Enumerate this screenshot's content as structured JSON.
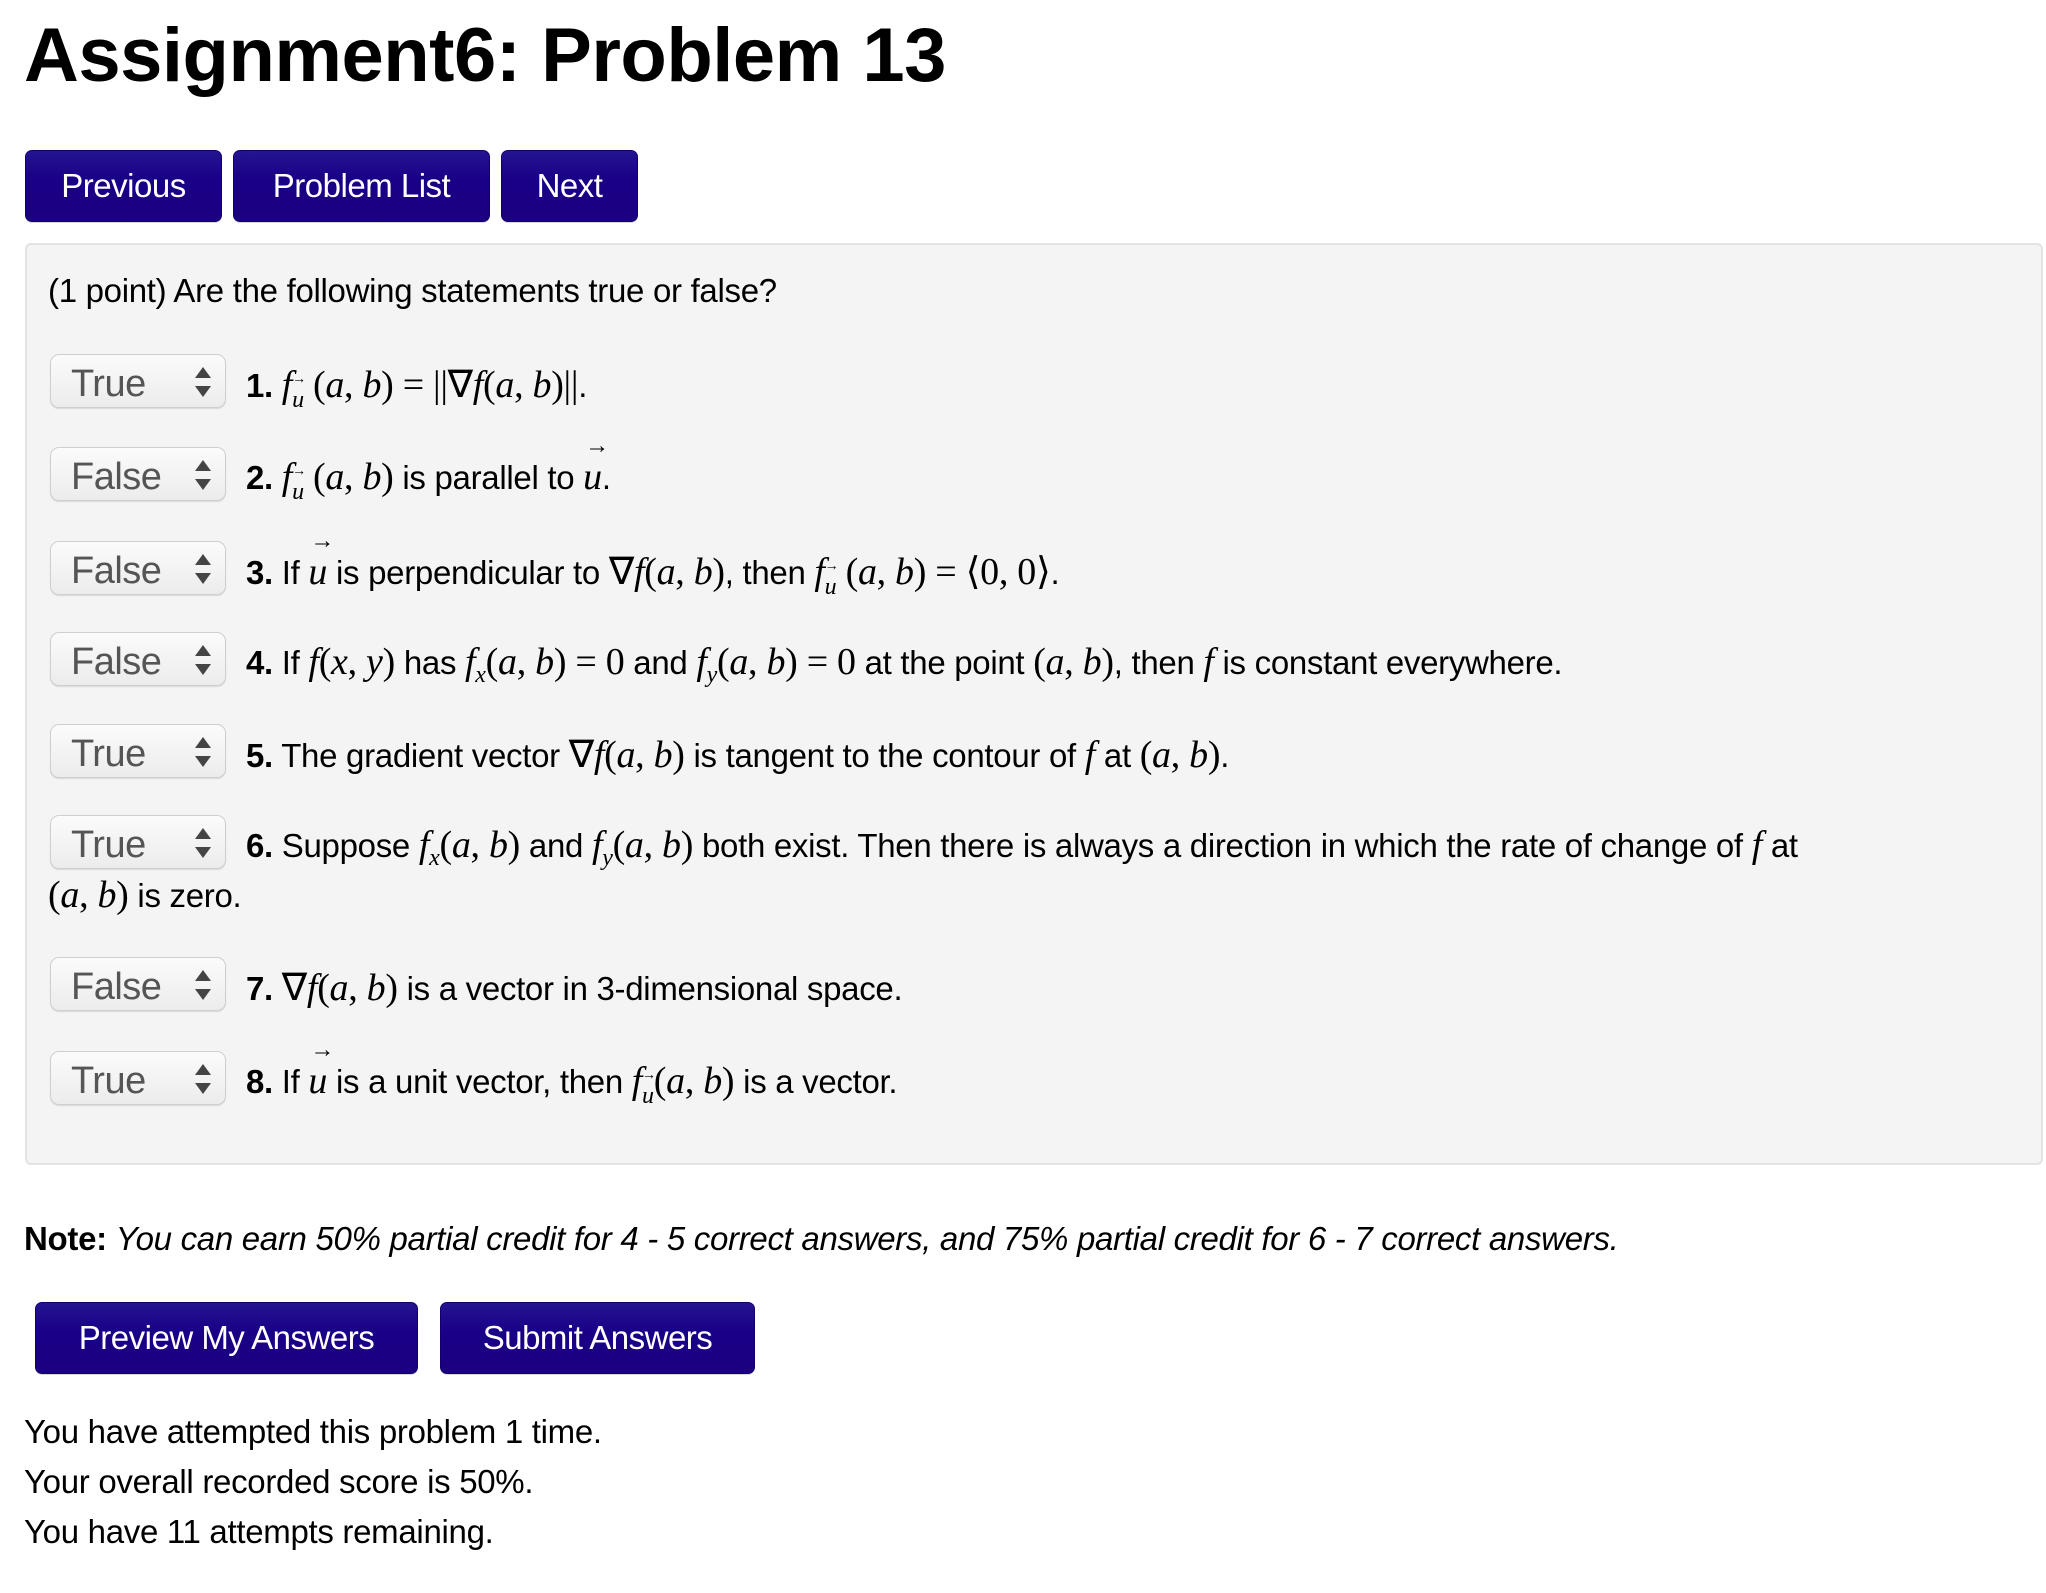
{
  "page": {
    "title": "Assignment6: Problem 13"
  },
  "nav": {
    "previous_label": "Previous",
    "problem_list_label": "Problem List",
    "next_label": "Next",
    "button_color": "#1a0087"
  },
  "problem": {
    "intro": "(1 point) Are the following statements true or false?",
    "select_options": [
      "True",
      "False"
    ],
    "statements": [
      {
        "number": "1.",
        "answer": "True",
        "parts": [
          "f",
          "u",
          " (a, b) = ||∇f(a, b)||."
        ],
        "text": "f_u(a, b) = ||∇f(a, b)||."
      },
      {
        "number": "2.",
        "answer": "False",
        "text": "f_u(a, b) is parallel to u."
      },
      {
        "number": "3.",
        "answer": "False",
        "text": "If u is perpendicular to ∇f(a, b), then f_u(a, b) = ⟨0, 0⟩."
      },
      {
        "number": "4.",
        "answer": "False",
        "text": "If f(x, y) has f_x(a, b) = 0 and f_y(a, b) = 0 at the point (a, b), then f is constant everywhere."
      },
      {
        "number": "5.",
        "answer": "True",
        "text": "The gradient vector ∇f(a, b) is tangent to the contour of f at (a, b)."
      },
      {
        "number": "6.",
        "answer": "True",
        "text": "Suppose f_x(a, b) and f_y(a, b) both exist. Then there is always a direction in which the rate of change of f at (a, b) is zero."
      },
      {
        "number": "7.",
        "answer": "False",
        "text": "∇f(a, b) is a vector in 3-dimensional space."
      },
      {
        "number": "8.",
        "answer": "True",
        "text": "If u is a unit vector, then f_u(a, b) is a vector."
      }
    ],
    "words": {
      "is_parallel_to": "is parallel to",
      "if": "If",
      "is_perpendicular_to": "is perpendicular to",
      "then": ", then",
      "has": "has",
      "and": "and",
      "at_the_point": "at the point",
      "then_plain": "then",
      "is_constant_everywhere": "is constant everywhere.",
      "the_gradient_vector": "The gradient vector",
      "is_tangent_to_contour_of": "is tangent to the contour of",
      "at": "at",
      "suppose": "Suppose",
      "both_exist": "both exist. Then there is always a direction in which the rate of change of",
      "is_zero": "is zero.",
      "is_vector_3d": "is a vector in 3-dimensional space.",
      "is_unit_vector_then": "is a unit vector, then",
      "is_a_vector": "is a vector."
    }
  },
  "note": {
    "label": "Note:",
    "text": "You can earn 50% partial credit for 4 - 5 correct answers, and 75% partial credit for 6 - 7 correct answers."
  },
  "actions": {
    "preview_label": "Preview My Answers",
    "submit_label": "Submit Answers"
  },
  "status": {
    "attempts": "You have attempted this problem 1 time.",
    "score": "Your overall recorded score is 50%.",
    "remaining": "You have 11 attempts remaining."
  }
}
